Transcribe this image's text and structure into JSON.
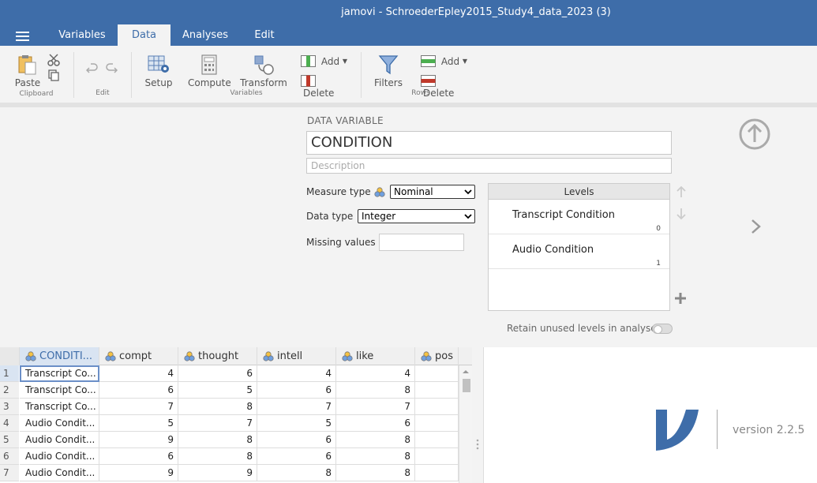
{
  "window": {
    "title": "jamovi - SchroederEpley2015_Study4_data_2023 (3)"
  },
  "tabs": [
    {
      "label": "Variables",
      "active": false
    },
    {
      "label": "Data",
      "active": true
    },
    {
      "label": "Analyses",
      "active": false
    },
    {
      "label": "Edit",
      "active": false
    }
  ],
  "ribbon": {
    "paste": "Paste",
    "setup": "Setup",
    "compute": "Compute",
    "transform": "Transform",
    "add_var": "Add",
    "delete_var": "Delete",
    "filters": "Filters",
    "add_row": "Add",
    "delete_row": "Delete",
    "groups": {
      "clipboard": "Clipboard",
      "edit": "Edit",
      "variables": "Variables",
      "rows": "Rows"
    }
  },
  "editor": {
    "section_label": "DATA VARIABLE",
    "name": "CONDITION",
    "description_placeholder": "Description",
    "measure_type_label": "Measure type",
    "measure_type": "Nominal",
    "data_type_label": "Data type",
    "data_type": "Integer",
    "missing_values_label": "Missing values",
    "levels_title": "Levels",
    "levels": [
      {
        "name": "Transcript Condition",
        "value": "0"
      },
      {
        "name": "Audio Condition",
        "value": "1"
      }
    ],
    "retain_label": "Retain unused levels in analyses"
  },
  "sheet": {
    "columns": [
      "CONDITI...",
      "compt",
      "thought",
      "intell",
      "like",
      "pos"
    ],
    "rows": [
      [
        "1",
        "Transcript Co...",
        "4",
        "6",
        "4",
        "4"
      ],
      [
        "2",
        "Transcript Co...",
        "6",
        "5",
        "6",
        "8"
      ],
      [
        "3",
        "Transcript Co...",
        "7",
        "8",
        "7",
        "7"
      ],
      [
        "4",
        "Audio Condit...",
        "5",
        "7",
        "5",
        "6"
      ],
      [
        "5",
        "Audio Condit...",
        "9",
        "8",
        "6",
        "8"
      ],
      [
        "6",
        "Audio Condit...",
        "6",
        "8",
        "6",
        "8"
      ],
      [
        "7",
        "Audio Condit...",
        "9",
        "9",
        "8",
        "8"
      ]
    ]
  },
  "results": {
    "version": "version 2.2.5"
  },
  "colors": {
    "brand": "#3e6da9",
    "logo": "#3e6da9"
  }
}
